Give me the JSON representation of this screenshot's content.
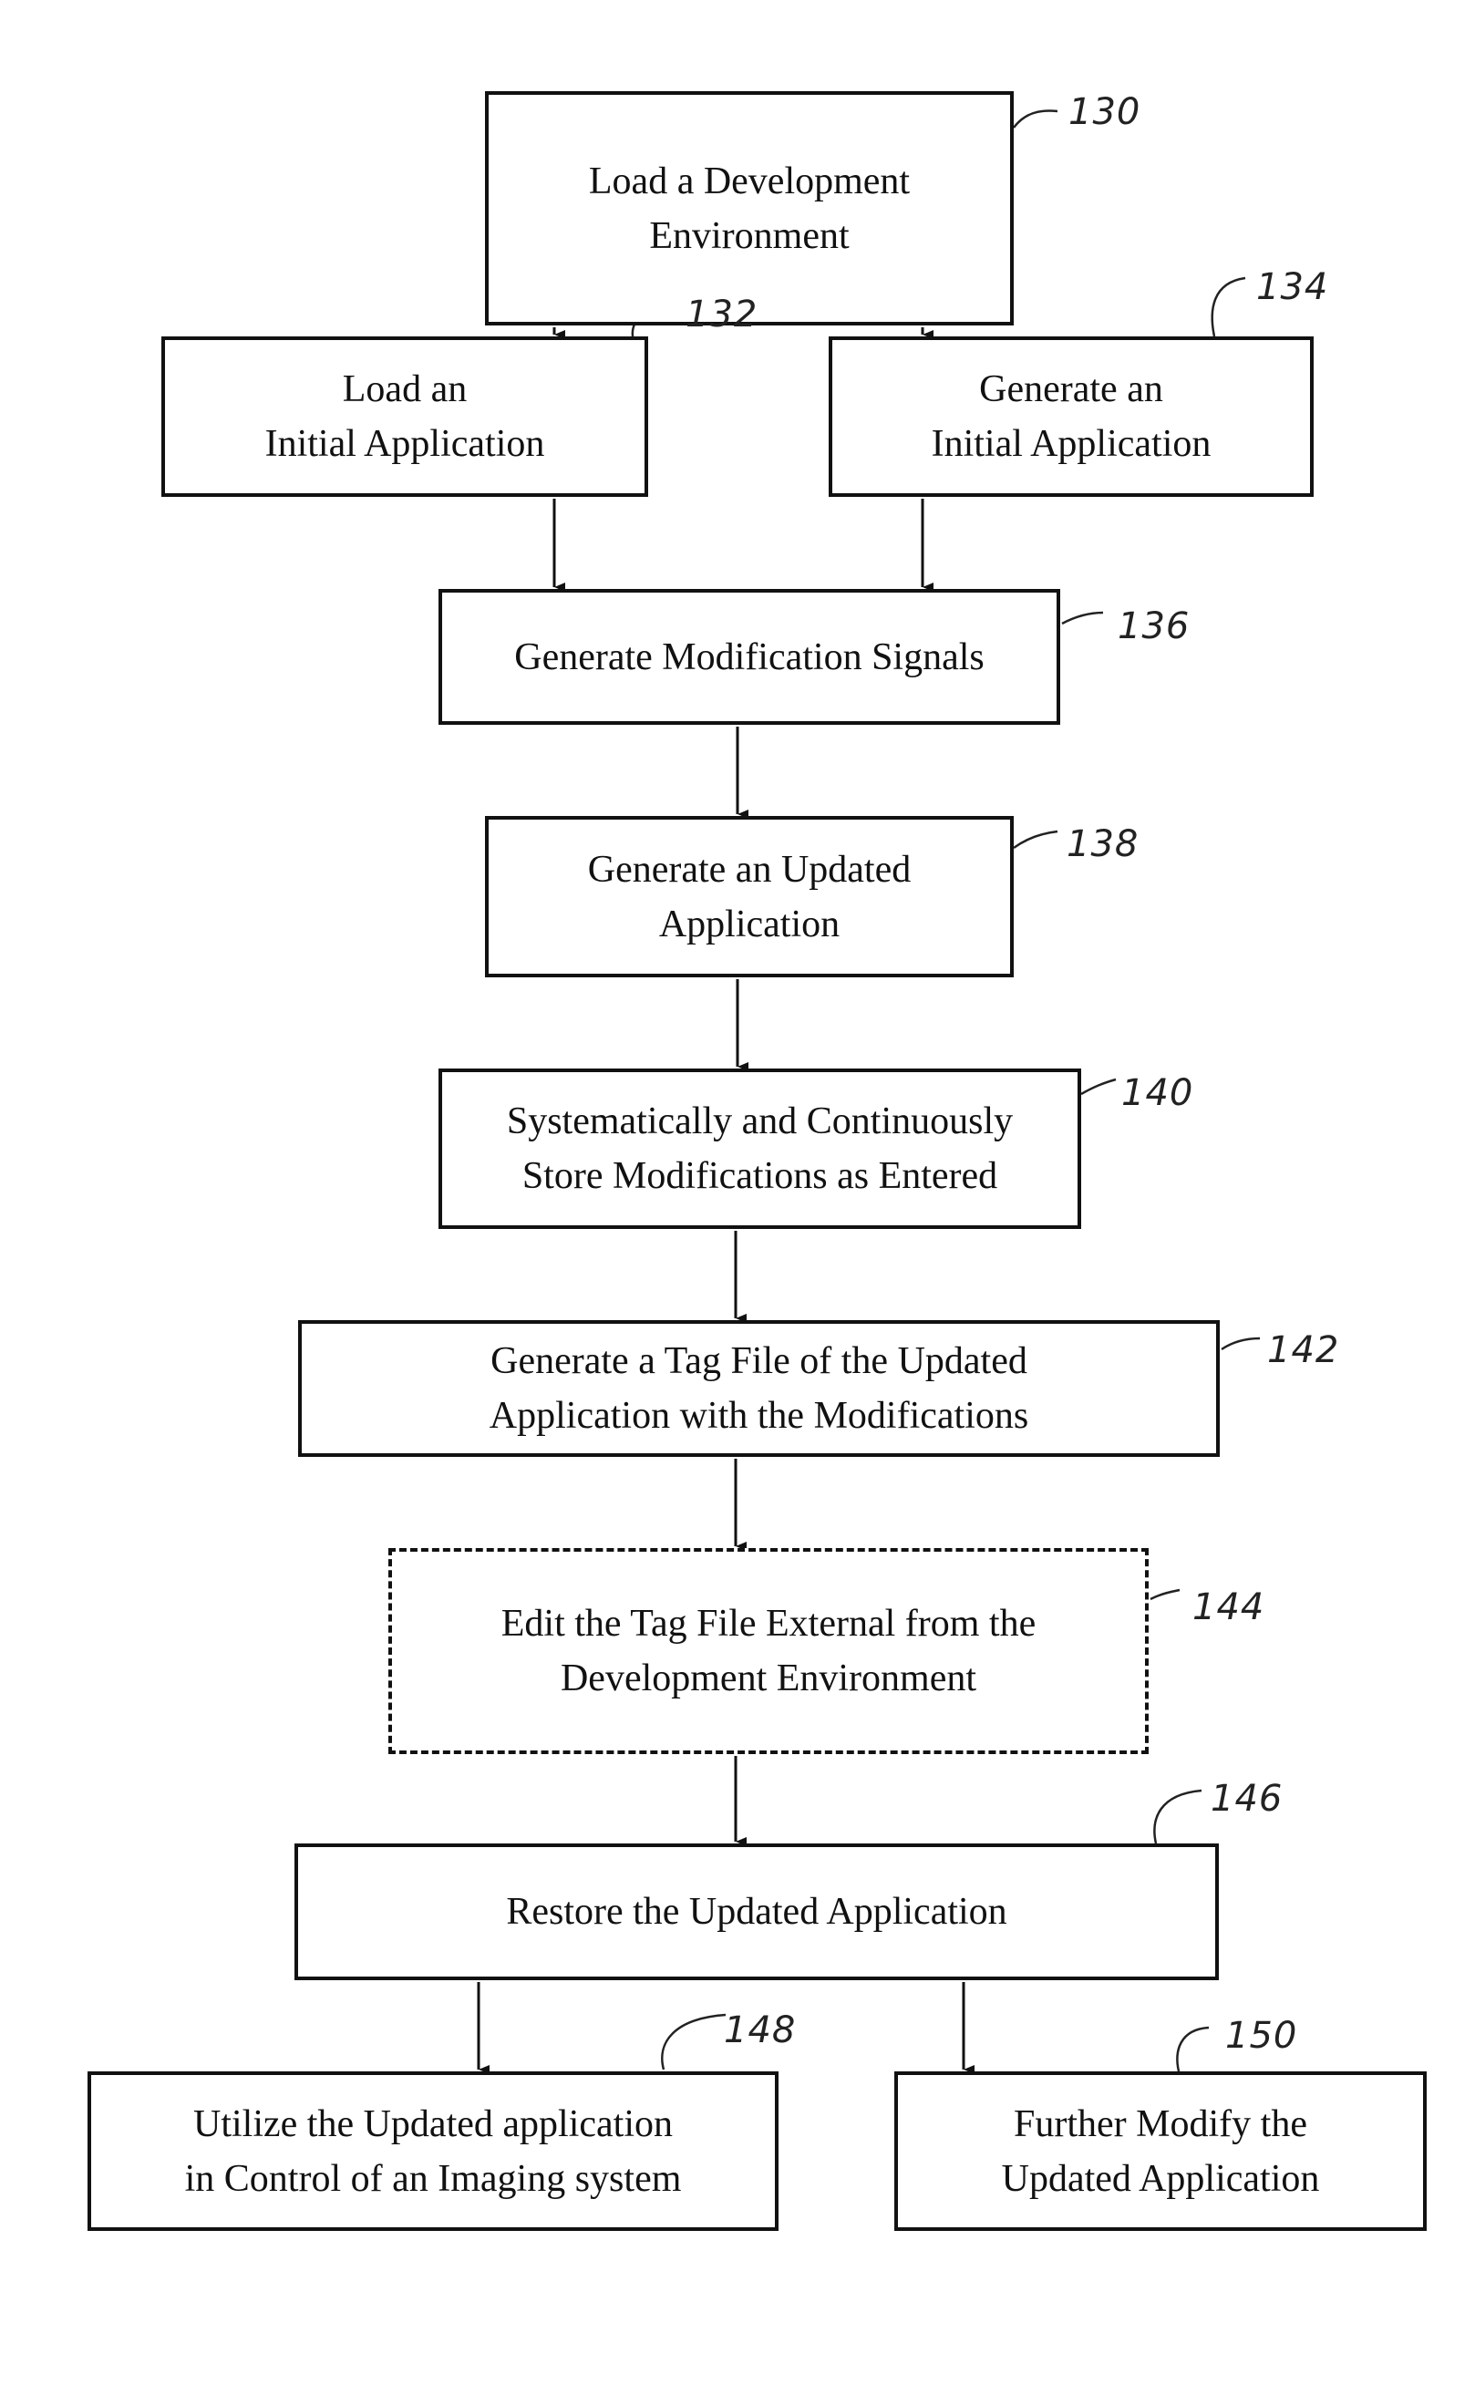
{
  "figure": {
    "type": "flowchart",
    "steps": [
      {
        "id": "130",
        "ref": "130",
        "lines": [
          "Load a Development",
          "Environment"
        ],
        "style": "solid"
      },
      {
        "id": "132",
        "ref": "132",
        "lines": [
          "Load an",
          "Initial Application"
        ],
        "style": "solid"
      },
      {
        "id": "134",
        "ref": "134",
        "lines": [
          "Generate an",
          "Initial Application"
        ],
        "style": "solid"
      },
      {
        "id": "136",
        "ref": "136",
        "lines": [
          "Generate Modification Signals"
        ],
        "style": "solid"
      },
      {
        "id": "138",
        "ref": "138",
        "lines": [
          "Generate an Updated",
          "Application"
        ],
        "style": "solid"
      },
      {
        "id": "140",
        "ref": "140",
        "lines": [
          "Systematically and Continuously",
          "Store Modifications as Entered"
        ],
        "style": "solid"
      },
      {
        "id": "142",
        "ref": "142",
        "lines": [
          "Generate a Tag File of the Updated",
          "Application with the Modifications"
        ],
        "style": "solid"
      },
      {
        "id": "144",
        "ref": "144",
        "lines": [
          "Edit the Tag File External from the",
          "Development Environment"
        ],
        "style": "dashed"
      },
      {
        "id": "146",
        "ref": "146",
        "lines": [
          "Restore the Updated Application"
        ],
        "style": "solid"
      },
      {
        "id": "148",
        "ref": "148",
        "lines": [
          "Utilize the Updated application",
          "in Control of an Imaging system"
        ],
        "style": "solid"
      },
      {
        "id": "150",
        "ref": "150",
        "lines": [
          "Further Modify the",
          "Updated Application"
        ],
        "style": "solid"
      }
    ],
    "connections": [
      {
        "from": "130",
        "to": "132"
      },
      {
        "from": "130",
        "to": "134"
      },
      {
        "from": "132",
        "to": "136"
      },
      {
        "from": "134",
        "to": "136"
      },
      {
        "from": "136",
        "to": "138"
      },
      {
        "from": "138",
        "to": "140"
      },
      {
        "from": "140",
        "to": "142"
      },
      {
        "from": "142",
        "to": "144"
      },
      {
        "from": "144",
        "to": "146"
      },
      {
        "from": "146",
        "to": "148"
      },
      {
        "from": "146",
        "to": "150"
      }
    ]
  }
}
